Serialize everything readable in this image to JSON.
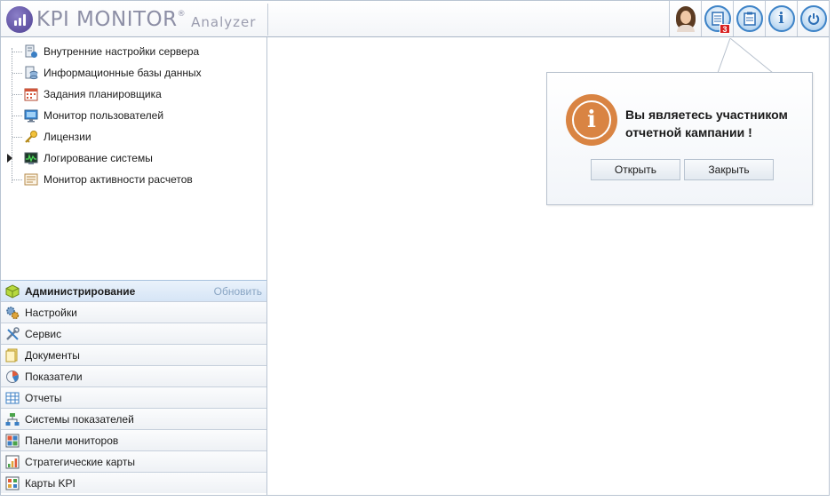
{
  "app": {
    "logo_text": "KPI MONITOR",
    "logo_reg": "®",
    "logo_sub": "Analyzer"
  },
  "header": {
    "buttons": [
      {
        "name": "user-avatar",
        "icon": "user-avatar-icon"
      },
      {
        "name": "tasks",
        "icon": "document-list-icon",
        "badge": "3"
      },
      {
        "name": "clipboard",
        "icon": "clipboard-icon"
      },
      {
        "name": "info",
        "icon": "info-icon",
        "glyph": "i"
      },
      {
        "name": "power",
        "icon": "power-icon"
      }
    ]
  },
  "tree": {
    "items": [
      {
        "label": "Внутренние настройки сервера",
        "icon": "server-settings-icon"
      },
      {
        "label": "Информационные базы данных",
        "icon": "database-icon"
      },
      {
        "label": "Задания планировщика",
        "icon": "scheduler-icon"
      },
      {
        "label": "Монитор пользователей",
        "icon": "monitor-icon"
      },
      {
        "label": "Лицензии",
        "icon": "key-icon"
      },
      {
        "label": "Логирование системы",
        "icon": "log-icon",
        "expandable": true
      },
      {
        "label": "Монитор активности расчетов",
        "icon": "calc-activity-icon"
      }
    ]
  },
  "accordion": {
    "refresh_label": "Обновить",
    "items": [
      {
        "label": "Администрирование",
        "icon": "admin-cube-icon",
        "active": true
      },
      {
        "label": "Настройки",
        "icon": "settings-gears-icon"
      },
      {
        "label": "Сервис",
        "icon": "tools-icon"
      },
      {
        "label": "Документы",
        "icon": "documents-icon"
      },
      {
        "label": "Показатели",
        "icon": "indicators-icon"
      },
      {
        "label": "Отчеты",
        "icon": "reports-table-icon"
      },
      {
        "label": "Системы показателей",
        "icon": "hierarchy-icon"
      },
      {
        "label": "Панели мониторов",
        "icon": "dashboard-icon"
      },
      {
        "label": "Стратегические карты",
        "icon": "strategy-map-icon"
      },
      {
        "label": "Карты KPI",
        "icon": "kpi-card-icon"
      }
    ]
  },
  "popup": {
    "message_line1": "Вы являетесь участником",
    "message_line2": "отчетной кампании !",
    "open_label": "Открыть",
    "close_label": "Закрыть",
    "icon_glyph": "i"
  },
  "colors": {
    "accent": "#3d83c7",
    "popup_icon": "#d98443",
    "badge": "#d82020",
    "logo_purple": "#4d3f92"
  }
}
